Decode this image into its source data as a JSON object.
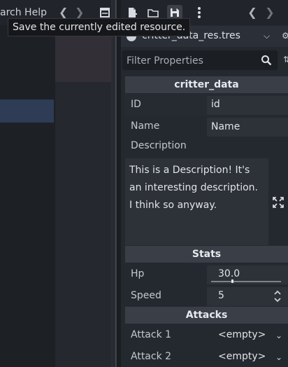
{
  "left_panel": {
    "menu_fragment": "arch Help"
  },
  "inspector": {
    "toolbar": {
      "tooltip": "Save the currently edited resource."
    },
    "resource": {
      "name": "critter_data_res.tres"
    },
    "filter": {
      "placeholder": "Filter Properties"
    },
    "sections": {
      "critter_data": "critter_data",
      "stats": "Stats",
      "attacks": "Attacks"
    },
    "properties": {
      "id": {
        "label": "ID",
        "value": "id"
      },
      "name": {
        "label": "Name",
        "value": "Name"
      },
      "description": {
        "label": "Description",
        "value": "This is a Description! It's an interesting description. I think so anyway."
      },
      "hp": {
        "label": "Hp",
        "value": "30.0",
        "slider_fraction": 0.3
      },
      "speed": {
        "label": "Speed",
        "value": "5"
      },
      "attack1": {
        "label": "Attack 1",
        "value": "<empty>"
      },
      "attack2": {
        "label": "Attack 2",
        "value": "<empty>"
      }
    }
  },
  "icons": [
    "search-icon",
    "save-icon",
    "new-resource-icon",
    "load-icon",
    "more-icon",
    "expand-icon",
    "chevron-down-icon",
    "spinner-icon"
  ],
  "colors": {
    "panel_bg": "#24282f",
    "header_bg": "#3a3f47",
    "selection": "#2e3c55"
  }
}
